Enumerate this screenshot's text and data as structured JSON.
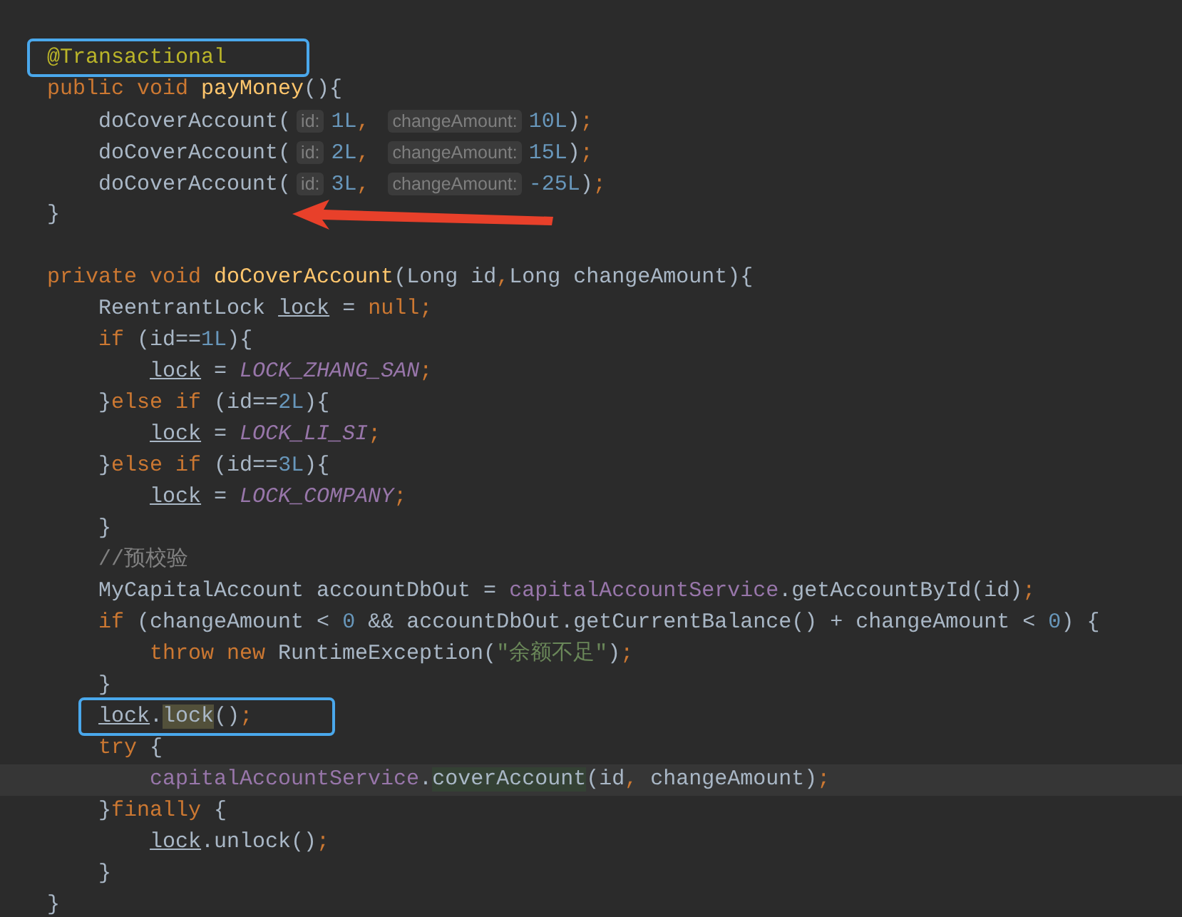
{
  "editor": {
    "methods": [
      {
        "lines": [
          {
            "current": false,
            "boxed": true,
            "tokens": [
              {
                "text": "@Transactional",
                "kind": "annotation"
              }
            ]
          },
          {
            "current": false,
            "boxed": false,
            "tokens": [
              {
                "text": "public void ",
                "kind": "keyword"
              },
              {
                "text": "payMoney",
                "kind": "declaration"
              },
              {
                "text": "(){",
                "kind": "plain"
              }
            ]
          },
          {
            "current": false,
            "boxed": false,
            "tokens": [
              {
                "text": "    doCoverAccount(",
                "kind": "plain"
              },
              {
                "text": "id:",
                "kind": "hint"
              },
              {
                "text": "1L",
                "kind": "number"
              },
              {
                "text": ", ",
                "kind": "keyword"
              },
              {
                "text": "changeAmount:",
                "kind": "hint"
              },
              {
                "text": "10L",
                "kind": "number"
              },
              {
                "text": ")",
                "kind": "plain"
              },
              {
                "text": ";",
                "kind": "keyword"
              }
            ]
          },
          {
            "current": false,
            "boxed": false,
            "tokens": [
              {
                "text": "    doCoverAccount(",
                "kind": "plain"
              },
              {
                "text": "id:",
                "kind": "hint"
              },
              {
                "text": "2L",
                "kind": "number"
              },
              {
                "text": ", ",
                "kind": "keyword"
              },
              {
                "text": "changeAmount:",
                "kind": "hint"
              },
              {
                "text": "15L",
                "kind": "number"
              },
              {
                "text": ")",
                "kind": "plain"
              },
              {
                "text": ";",
                "kind": "keyword"
              }
            ]
          },
          {
            "current": false,
            "boxed": false,
            "tokens": [
              {
                "text": "    doCoverAccount(",
                "kind": "plain"
              },
              {
                "text": "id:",
                "kind": "hint"
              },
              {
                "text": "3L",
                "kind": "number"
              },
              {
                "text": ", ",
                "kind": "keyword"
              },
              {
                "text": "changeAmount:",
                "kind": "hint"
              },
              {
                "text": "-25L",
                "kind": "number"
              },
              {
                "text": ")",
                "kind": "plain"
              },
              {
                "text": ";",
                "kind": "keyword"
              }
            ]
          },
          {
            "current": false,
            "boxed": false,
            "tokens": [
              {
                "text": "}",
                "kind": "plain"
              }
            ]
          }
        ]
      },
      {
        "lines": [
          {
            "current": false,
            "boxed": false,
            "tokens": [
              {
                "text": "private void ",
                "kind": "keyword"
              },
              {
                "text": "doCoverAccount",
                "kind": "declaration"
              },
              {
                "text": "(Long id",
                "kind": "plain"
              },
              {
                "text": ",",
                "kind": "keyword"
              },
              {
                "text": "Long changeAmount){",
                "kind": "plain"
              }
            ]
          },
          {
            "current": false,
            "boxed": false,
            "tokens": [
              {
                "text": "    ReentrantLock ",
                "kind": "plain"
              },
              {
                "text": "lock",
                "kind": "reassigned"
              },
              {
                "text": " = ",
                "kind": "plain"
              },
              {
                "text": "null;",
                "kind": "keyword"
              }
            ]
          },
          {
            "current": false,
            "boxed": false,
            "tokens": [
              {
                "text": "    if ",
                "kind": "keyword"
              },
              {
                "text": "(id==",
                "kind": "plain"
              },
              {
                "text": "1L",
                "kind": "number"
              },
              {
                "text": "){",
                "kind": "plain"
              }
            ]
          },
          {
            "current": false,
            "boxed": false,
            "tokens": [
              {
                "text": "        lock",
                "kind": "reassigned"
              },
              {
                "text": " = ",
                "kind": "plain"
              },
              {
                "text": "LOCK_ZHANG_SAN",
                "kind": "constant"
              },
              {
                "text": ";",
                "kind": "keyword"
              }
            ]
          },
          {
            "current": false,
            "boxed": false,
            "tokens": [
              {
                "text": "    }",
                "kind": "plain"
              },
              {
                "text": "else if ",
                "kind": "keyword"
              },
              {
                "text": "(id==",
                "kind": "plain"
              },
              {
                "text": "2L",
                "kind": "number"
              },
              {
                "text": "){",
                "kind": "plain"
              }
            ]
          },
          {
            "current": false,
            "boxed": false,
            "tokens": [
              {
                "text": "        lock",
                "kind": "reassigned"
              },
              {
                "text": " = ",
                "kind": "plain"
              },
              {
                "text": "LOCK_LI_SI",
                "kind": "constant"
              },
              {
                "text": ";",
                "kind": "keyword"
              }
            ]
          },
          {
            "current": false,
            "boxed": false,
            "tokens": [
              {
                "text": "    }",
                "kind": "plain"
              },
              {
                "text": "else if ",
                "kind": "keyword"
              },
              {
                "text": "(id==",
                "kind": "plain"
              },
              {
                "text": "3L",
                "kind": "number"
              },
              {
                "text": "){",
                "kind": "plain"
              }
            ]
          },
          {
            "current": false,
            "boxed": false,
            "tokens": [
              {
                "text": "        lock",
                "kind": "reassigned"
              },
              {
                "text": " = ",
                "kind": "plain"
              },
              {
                "text": "LOCK_COMPANY",
                "kind": "constant"
              },
              {
                "text": ";",
                "kind": "keyword"
              }
            ]
          },
          {
            "current": false,
            "boxed": false,
            "tokens": [
              {
                "text": "    }",
                "kind": "plain"
              }
            ]
          },
          {
            "current": false,
            "boxed": false,
            "tokens": [
              {
                "text": "    //预校验",
                "kind": "comment"
              }
            ]
          },
          {
            "current": false,
            "boxed": false,
            "tokens": [
              {
                "text": "    MyCapitalAccount accountDbOut = ",
                "kind": "plain"
              },
              {
                "text": "capitalAccountService",
                "kind": "field"
              },
              {
                "text": ".getAccountById(id)",
                "kind": "plain"
              },
              {
                "text": ";",
                "kind": "keyword"
              }
            ]
          },
          {
            "current": false,
            "boxed": false,
            "tokens": [
              {
                "text": "    if ",
                "kind": "keyword"
              },
              {
                "text": "(changeAmount < ",
                "kind": "plain"
              },
              {
                "text": "0",
                "kind": "number"
              },
              {
                "text": " && accountDbOut.getCurrentBalance() + changeAmount < ",
                "kind": "plain"
              },
              {
                "text": "0",
                "kind": "number"
              },
              {
                "text": ") {",
                "kind": "plain"
              }
            ]
          },
          {
            "current": false,
            "boxed": false,
            "tokens": [
              {
                "text": "        throw new ",
                "kind": "keyword"
              },
              {
                "text": "RuntimeException(",
                "kind": "plain"
              },
              {
                "text": "\"余额不足\"",
                "kind": "string"
              },
              {
                "text": ")",
                "kind": "plain"
              },
              {
                "text": ";",
                "kind": "keyword"
              }
            ]
          },
          {
            "current": false,
            "boxed": false,
            "tokens": [
              {
                "text": "    }",
                "kind": "plain"
              }
            ]
          },
          {
            "current": false,
            "boxed": true,
            "tokens": [
              {
                "text": "    lock",
                "kind": "reassigned"
              },
              {
                "text": ".",
                "kind": "plain"
              },
              {
                "text": "lock",
                "kind": "usage"
              },
              {
                "text": "()",
                "kind": "plain"
              },
              {
                "text": ";",
                "kind": "keyword"
              }
            ]
          },
          {
            "current": false,
            "boxed": false,
            "tokens": [
              {
                "text": "    try ",
                "kind": "keyword"
              },
              {
                "text": "{",
                "kind": "plain"
              }
            ]
          },
          {
            "current": true,
            "boxed": false,
            "tokens": [
              {
                "text": "        capitalAccountService",
                "kind": "field"
              },
              {
                "text": ".",
                "kind": "plain"
              },
              {
                "text": "coverAccount",
                "kind": "match"
              },
              {
                "text": "(id",
                "kind": "plain"
              },
              {
                "text": ", ",
                "kind": "keyword"
              },
              {
                "text": "changeAmount)",
                "kind": "plain"
              },
              {
                "text": ";",
                "kind": "keyword"
              }
            ]
          },
          {
            "current": false,
            "boxed": false,
            "tokens": [
              {
                "text": "    }",
                "kind": "plain"
              },
              {
                "text": "finally ",
                "kind": "keyword"
              },
              {
                "text": "{",
                "kind": "plain"
              }
            ]
          },
          {
            "current": false,
            "boxed": false,
            "tokens": [
              {
                "text": "        lock",
                "kind": "reassigned"
              },
              {
                "text": ".unlock()",
                "kind": "plain"
              },
              {
                "text": ";",
                "kind": "keyword"
              }
            ]
          },
          {
            "current": false,
            "boxed": false,
            "tokens": [
              {
                "text": "    }",
                "kind": "plain"
              }
            ]
          },
          {
            "current": false,
            "boxed": false,
            "tokens": [
              {
                "text": "}",
                "kind": "plain"
              }
            ]
          }
        ]
      }
    ]
  }
}
